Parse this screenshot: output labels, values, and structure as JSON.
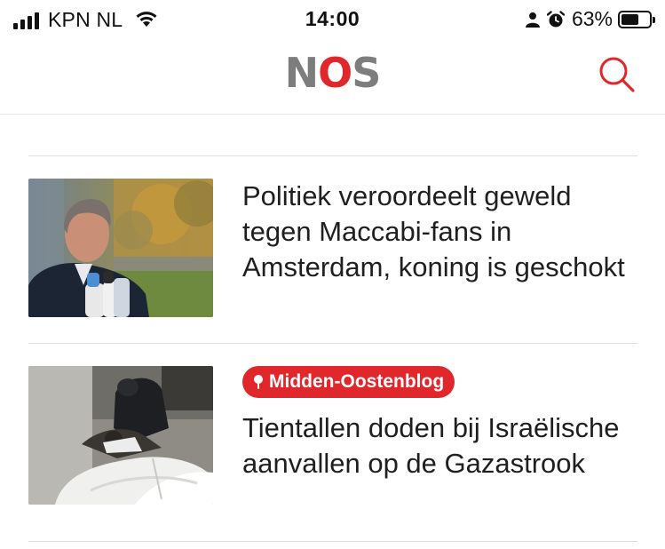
{
  "status_bar": {
    "carrier": "KPN NL",
    "time": "14:00",
    "battery_percent": "63%",
    "battery_level": 0.63,
    "icons": [
      "signal-icon",
      "wifi-icon",
      "person-icon",
      "alarm-icon",
      "battery-icon"
    ]
  },
  "header": {
    "logo": {
      "n": "N",
      "o": "O",
      "s": "S"
    },
    "logo_colors": {
      "letters": "#7d7d7d",
      "accent": "#e0272c"
    },
    "search_icon": "search-icon"
  },
  "articles": [
    {
      "headline": "Politiek veroordeelt geweld tegen Maccabi-fans in Amsterdam, koning is geschokt",
      "image": "politician-interview-photo"
    },
    {
      "tag": "Midden-Oostenblog",
      "tag_icon": "pin-icon",
      "headline": "Tientallen doden bij Israëlische aanvallen op de Gazastrook",
      "image": "gaza-mourning-photo"
    }
  ],
  "colors": {
    "accent": "#e0272c",
    "text": "#1f1f1f",
    "divider": "#dedede"
  }
}
